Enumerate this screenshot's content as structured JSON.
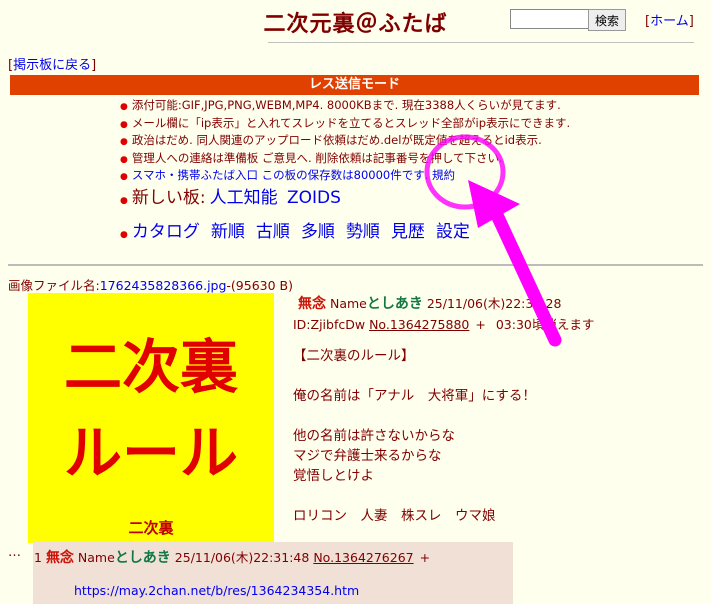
{
  "header": {
    "title": "二次元裏＠ふたば",
    "search_button": "検索",
    "home_link": "ホーム",
    "bracket_open": "[",
    "bracket_close": "]"
  },
  "back_link": "掲示板に戻る",
  "mode_bar": "レス送信モード",
  "notes": [
    "添付可能:GIF,JPG,PNG,WEBM,MP4. 8000KBまで. 現在3388人くらいが見てます.",
    "メール欄に「ip表示」と入れてスレッドを立てるとスレッド全部がip表示にできます.",
    "政治はだめ. 同人関連のアップロード依頼はだめ.delが既定値を超えるとid表示.",
    "管理人への連絡は準備板 ご意見へ. 削除依頼は記事番号を押して下さい.",
    "スマホ・携帯ふたば入口 この板の保存数は80000件です. 規約"
  ],
  "new_board": {
    "label": "新しい板:",
    "links": [
      "人工知能",
      "ZOIDS"
    ]
  },
  "nav_links": [
    "カタログ",
    "新順",
    "古順",
    "多順",
    "勢順",
    "見歴",
    "設定"
  ],
  "thread": {
    "file_label": "画像ファイル名:",
    "file_name": "1762435828366.jpg",
    "file_size": "-(95630 B)",
    "thumb_line1": "二次裏",
    "thumb_line2": "ルール",
    "thumb_small": "二次裏",
    "subject": "無念",
    "name_label": "Name",
    "name": "としあき",
    "date": "25/11/06(木)22:30:28",
    "id": "ID:ZjibfcDw",
    "post_no": "No.1364275880",
    "plus": "+",
    "expire": "03:30頃消えます",
    "body": "【二次裏のルール】\n\n俺の名前は「アナル　大将軍」にする！\n\n他の名前は許さないからな\nマジで弁護士来るからな\n覚悟しとけよ\n\nロリコン　人妻　株スレ　ウマ娘"
  },
  "reply": {
    "mark": "…",
    "index": "1",
    "subject": "無念",
    "name_label": "Name",
    "name": "としあき",
    "date": "25/11/06(木)22:31:48",
    "post_no": "No.1364276267",
    "plus": "+",
    "body_link": "https://may.2chan.net/b/res/1364234354.htm"
  },
  "colors": {
    "background": "#ffffee",
    "text": "#800000",
    "link": "#0000ee",
    "mode_bar": "#e04000",
    "annotation": "#ff00ff",
    "thumb_bg": "#ffff00"
  }
}
